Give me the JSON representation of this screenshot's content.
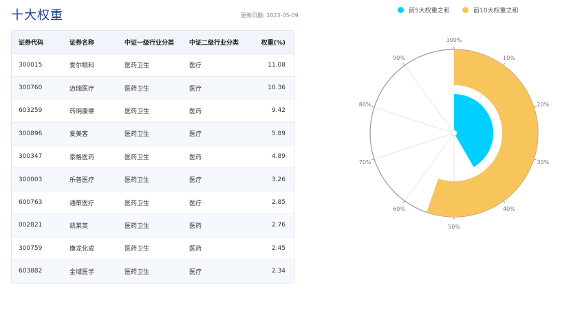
{
  "header": {
    "title": "十大权重",
    "update_date": "更新日期: 2023-05-09"
  },
  "table": {
    "columns": [
      "证券代码",
      "证券名称",
      "中证一级行业分类",
      "中证二级行业分类",
      "权重(%)"
    ],
    "rows": [
      [
        "300015",
        "爱尔眼科",
        "医药卫生",
        "医疗",
        "11.08"
      ],
      [
        "300760",
        "迈瑞医疗",
        "医药卫生",
        "医疗",
        "10.36"
      ],
      [
        "603259",
        "药明康德",
        "医药卫生",
        "医药",
        "9.42"
      ],
      [
        "300896",
        "爱美客",
        "医药卫生",
        "医疗",
        "5.89"
      ],
      [
        "300347",
        "泰格医药",
        "医药卫生",
        "医药",
        "4.89"
      ],
      [
        "300003",
        "乐普医疗",
        "医药卫生",
        "医疗",
        "3.26"
      ],
      [
        "600763",
        "通策医疗",
        "医药卫生",
        "医疗",
        "2.85"
      ],
      [
        "002821",
        "凯莱英",
        "医药卫生",
        "医药",
        "2.76"
      ],
      [
        "300759",
        "康龙化成",
        "医药卫生",
        "医药",
        "2.45"
      ],
      [
        "603882",
        "金域医学",
        "医药卫生",
        "医疗",
        "2.34"
      ]
    ]
  },
  "chart_data": {
    "type": "polar-bar",
    "angle_axis": {
      "min": 0,
      "max": 100,
      "unit": "%",
      "tick_labels": [
        "100%",
        "10%",
        "20%",
        "30%",
        "40%",
        "50%",
        "60%",
        "70%",
        "80%",
        "90%"
      ]
    },
    "legend_position": "top-right",
    "series": [
      {
        "name": "前5大权重之和",
        "value": 41.64,
        "color": "#00cfff"
      },
      {
        "name": "前10大权重之和",
        "value": 55.31,
        "color": "#f8c55c"
      }
    ]
  }
}
